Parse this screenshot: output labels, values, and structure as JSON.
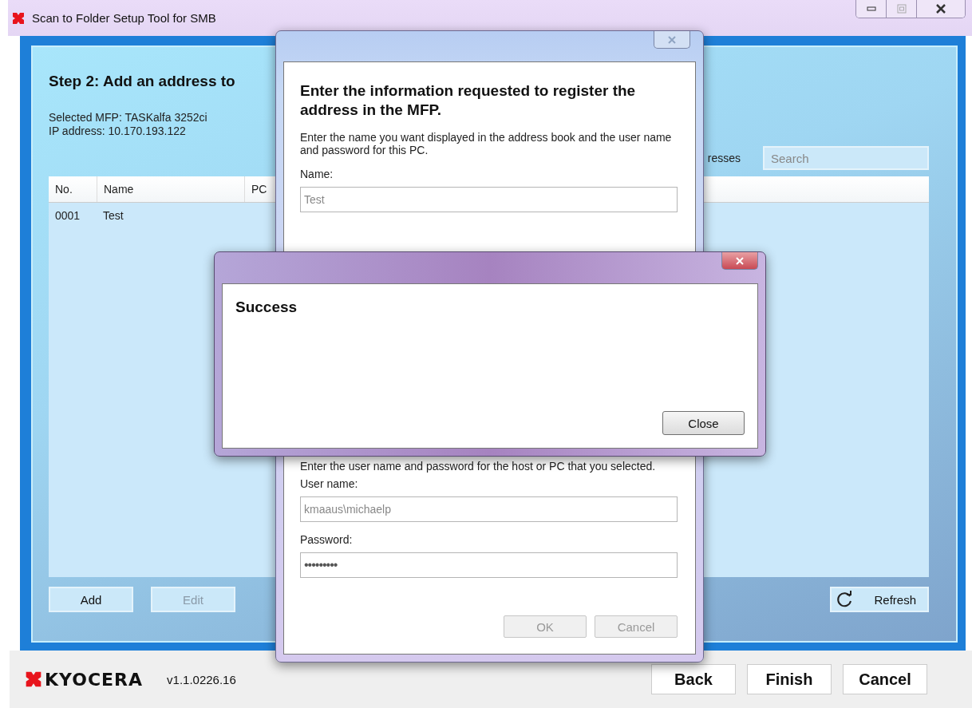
{
  "window": {
    "title": "Scan to Folder Setup Tool for SMB"
  },
  "step": {
    "heading": "Step 2: Add an address to",
    "mfp_line": "Selected MFP: TASKalfa 3252ci",
    "ip_line": "IP address: 10.170.193.122",
    "filter_label": "resses",
    "search": {
      "placeholder": "Search"
    }
  },
  "table": {
    "columns": [
      "No.",
      "Name",
      "PC"
    ],
    "rows": [
      [
        "0001",
        "Test"
      ]
    ]
  },
  "actions": [
    {
      "label": "Add",
      "disabled": false
    },
    {
      "label": "Edit",
      "disabled": true
    }
  ],
  "refresh": {
    "label": "Refresh"
  },
  "footer": {
    "logo": "KYOCERA",
    "version": "v1.1.0226.16",
    "buttons": [
      "Back",
      "Finish",
      "Cancel"
    ]
  },
  "register_dialog": {
    "heading": "Enter the information requested to register the address in the MFP.",
    "intro": "Enter the name you want displayed in the address book and the user name and password for this PC.",
    "name_label": "Name:",
    "name_value": "Test",
    "credentials_intro": "Enter the user name and password for the host or PC that you selected.",
    "user_label": "User name:",
    "user_value": "kmaaus\\michaelp",
    "password_label": "Password:",
    "password_value": "•••••••••",
    "buttons": [
      {
        "label": "OK",
        "disabled": true
      },
      {
        "label": "Cancel",
        "disabled": true
      }
    ]
  },
  "success_dialog": {
    "message": "Success",
    "button": "Close"
  }
}
